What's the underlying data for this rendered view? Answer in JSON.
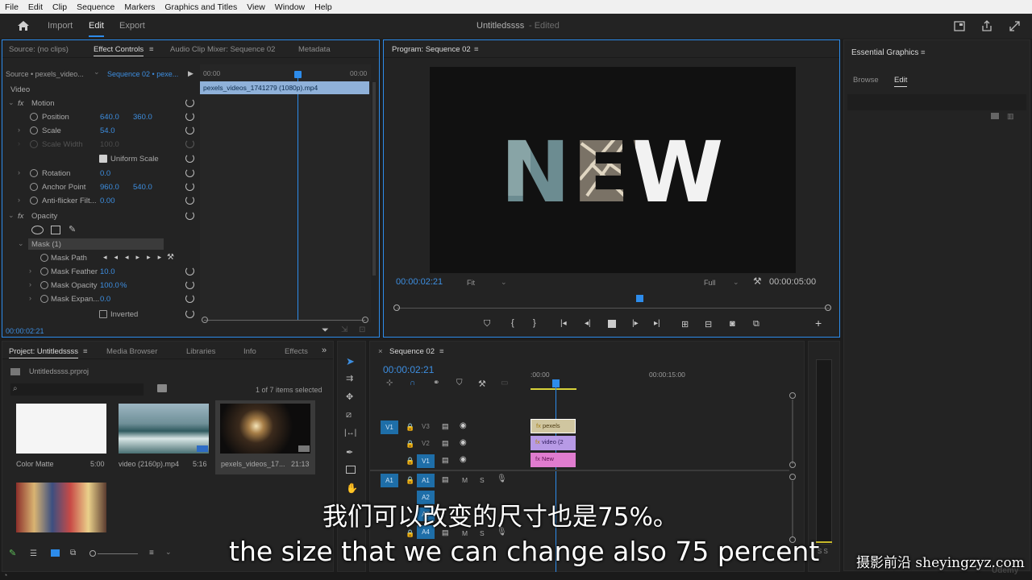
{
  "menu": [
    "File",
    "Edit",
    "Clip",
    "Sequence",
    "Markers",
    "Graphics and Titles",
    "View",
    "Window",
    "Help"
  ],
  "workspace": {
    "tabs": [
      "Import",
      "Edit",
      "Export"
    ],
    "project_title": "Untitledssss",
    "edited_label": "- Edited"
  },
  "source_panel": {
    "tabs": [
      "Source: (no clips)",
      "Effect Controls",
      "Audio Clip Mixer: Sequence 02",
      "Metadata"
    ],
    "source_select": "Source • pexels_video...",
    "sequence_select": "Sequence 02 • pexe...",
    "timeline_start": "00:00",
    "timeline_end": "00:00",
    "clip_name": "pexels_videos_1741279 (1080p).mp4",
    "video_header": "Video",
    "timecode": "00:00:02:21",
    "rows": {
      "motion": "Motion",
      "position": "Position",
      "position_x": "640.0",
      "position_y": "360.0",
      "scale": "Scale",
      "scale_v": "54.0",
      "scale_width": "Scale Width",
      "scale_width_v": "100.0",
      "uniform_scale": "Uniform Scale",
      "rotation": "Rotation",
      "rotation_v": "0.0",
      "anchor": "Anchor Point",
      "anchor_x": "960.0",
      "anchor_y": "540.0",
      "antiflicker": "Anti-flicker Filt...",
      "antiflicker_v": "0.00",
      "opacity": "Opacity",
      "mask": "Mask (1)",
      "mask_path": "Mask Path",
      "mask_feather": "Mask Feather",
      "mask_feather_v": "10.0",
      "mask_opacity": "Mask Opacity",
      "mask_opacity_v": "100.0",
      "mask_opacity_unit": "%",
      "mask_expansion": "Mask Expan...",
      "mask_expansion_v": "0.0",
      "inverted": "Inverted",
      "fx": "fx"
    }
  },
  "program": {
    "title": "Program: Sequence 02",
    "preview_text": "NEW",
    "timecode": "00:00:02:21",
    "fit": "Fit",
    "quality": "Full",
    "duration": "00:00:05:00"
  },
  "essential_graphics": {
    "title": "Essential Graphics",
    "tabs": [
      "Browse",
      "Edit"
    ]
  },
  "project_panel": {
    "tabs": [
      "Project: Untitledssss",
      "Media Browser",
      "Libraries",
      "Info",
      "Effects"
    ],
    "file": "Untitledssss.prproj",
    "selection_info": "1 of 7 items selected",
    "items": [
      {
        "name": "Color Matte",
        "duration": "5:00"
      },
      {
        "name": "video (2160p).mp4",
        "duration": "5:16"
      },
      {
        "name": "pexels_videos_17...",
        "duration": "21:13"
      },
      {
        "name": "",
        "duration": ""
      }
    ]
  },
  "timeline": {
    "title": "Sequence 02",
    "timecode": "00:00:02:21",
    "ruler_start": ":00:00",
    "ruler_mid": "00:00:15:00",
    "video_tracks": [
      "V3",
      "V2",
      "V1"
    ],
    "audio_tracks": [
      "A1",
      "A2",
      "A3",
      "A4"
    ],
    "source_v": "V1",
    "source_a": "A1",
    "clips": [
      {
        "label": "pexels",
        "color": "#d0c6a0"
      },
      {
        "label": "video (2",
        "color": "#b79ae6"
      },
      {
        "label": "New",
        "color": "#e07ccf"
      }
    ],
    "mute": "M",
    "solo": "S",
    "meter_labels": "S S"
  },
  "subtitles": {
    "chinese": "我们可以改变的尺寸也是75%。",
    "english": "the size that we can change also 75 percent"
  },
  "watermarks": {
    "site": "摄影前沿 sheyingzyz.com",
    "udemy": "Udemy"
  },
  "colors": {
    "accent": "#2d8ceb",
    "value_blue": "#3d8ee0",
    "track_blue": "#1e6ea8",
    "clip_selected": "#d0c6a0",
    "clip_purple": "#b79ae6",
    "clip_pink": "#e07ccf"
  }
}
